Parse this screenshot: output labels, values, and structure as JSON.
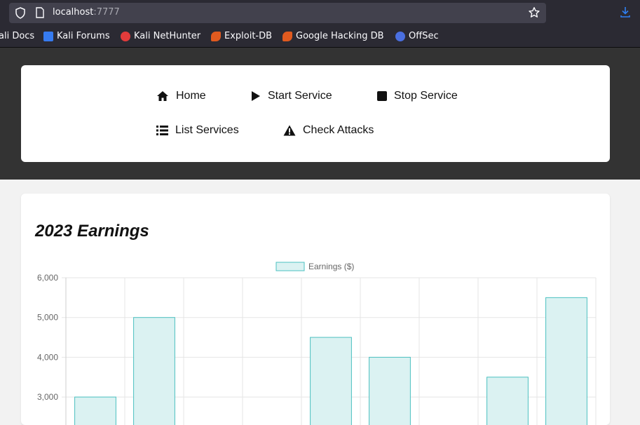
{
  "browser": {
    "url_host": "localhost",
    "url_port": ":7777",
    "bookmarks": [
      {
        "label": "ali Docs",
        "icon": "kali-docs-icon",
        "color": "#2b2a33"
      },
      {
        "label": "Kali Forums",
        "icon": "kali-forums-icon",
        "color": "#367bf0"
      },
      {
        "label": "Kali NetHunter",
        "icon": "kali-nethunter-icon",
        "color": "#e23b3b"
      },
      {
        "label": "Exploit-DB",
        "icon": "exploit-db-icon",
        "color": "#e05a1f"
      },
      {
        "label": "Google Hacking DB",
        "icon": "ghdb-icon",
        "color": "#e05a1f"
      },
      {
        "label": "OffSec",
        "icon": "offsec-icon",
        "color": "#4a6fe0"
      }
    ]
  },
  "nav": {
    "home": "Home",
    "start_service": "Start Service",
    "stop_service": "Stop Service",
    "list_services": "List Services",
    "check_attacks": "Check Attacks"
  },
  "main": {
    "title": "2023 Earnings"
  },
  "chart_data": {
    "type": "bar",
    "series": [
      {
        "name": "Earnings ($)",
        "values": [
          3000,
          5000,
          null,
          null,
          4500,
          4000,
          null,
          3500,
          5500
        ]
      }
    ],
    "yticks": [
      "6,000",
      "5,000",
      "4,000",
      "3,000"
    ],
    "ylim": [
      2500,
      6000
    ],
    "grid": true,
    "legend": "top-center",
    "colors": {
      "fill": "#dbf2f2",
      "stroke": "#4bc0c0",
      "grid": "#e5e5e5"
    }
  }
}
